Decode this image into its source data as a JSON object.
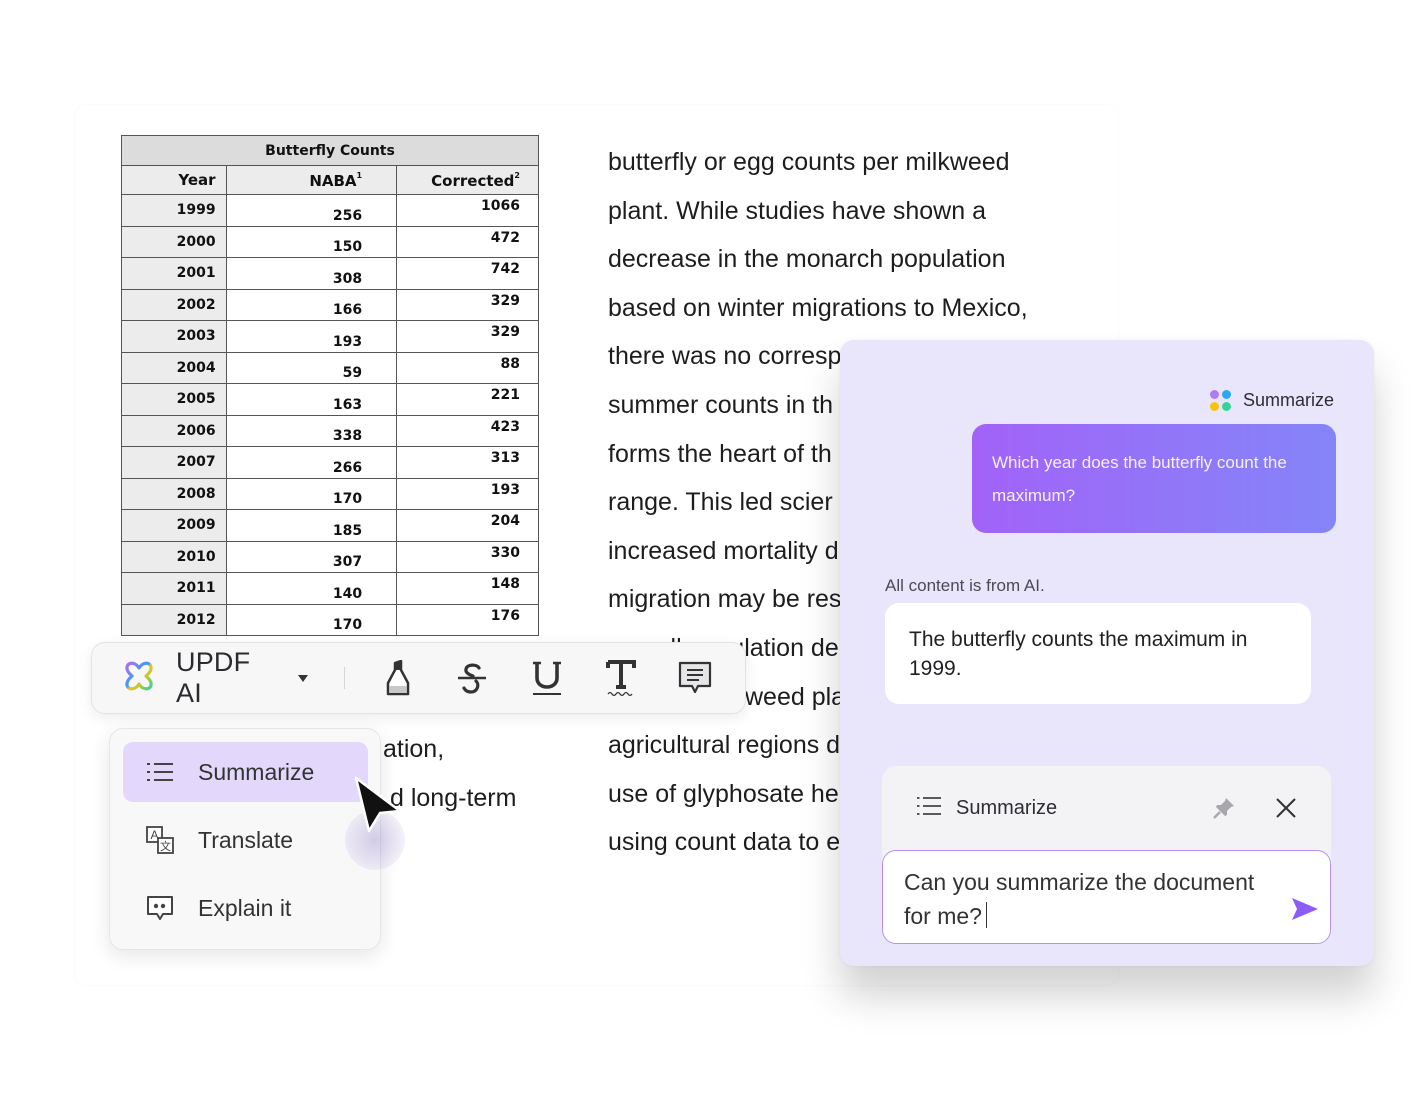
{
  "table": {
    "title": "Butterfly Counts",
    "columns": [
      {
        "label": "Year",
        "sup": ""
      },
      {
        "label": "NABA",
        "sup": "1"
      },
      {
        "label": "Corrected",
        "sup": "2"
      }
    ],
    "rows": [
      [
        "1999",
        "256",
        "1066"
      ],
      [
        "2000",
        "150",
        "472"
      ],
      [
        "2001",
        "308",
        "742"
      ],
      [
        "2002",
        "166",
        "329"
      ],
      [
        "2003",
        "193",
        "329"
      ],
      [
        "2004",
        "59",
        "88"
      ],
      [
        "2005",
        "163",
        "221"
      ],
      [
        "2006",
        "338",
        "423"
      ],
      [
        "2007",
        "266",
        "313"
      ],
      [
        "2008",
        "170",
        "193"
      ],
      [
        "2009",
        "185",
        "204"
      ],
      [
        "2010",
        "307",
        "330"
      ],
      [
        "2011",
        "140",
        "148"
      ],
      [
        "2012",
        "170",
        "176"
      ]
    ]
  },
  "document": {
    "lines": [
      "butterfly or egg counts per milkweed",
      "plant. While studies have shown a",
      "decrease in the monarch population",
      "based on winter migrations to Mexico,",
      "there was no corresp",
      "summer counts in th",
      "forms the heart of th",
      "range. This led scier",
      "increased mortality d",
      "migration may be res",
      "overall population de",
      "weed pla",
      "agricultural regions d",
      "use of glyphosate he",
      "using count data to e"
    ],
    "left_fragments": [
      "ation,",
      "d long-term"
    ]
  },
  "toolbar": {
    "ai_label": "UPDF AI",
    "tools": [
      {
        "name": "highlight-tool",
        "icon": "highlighter-icon"
      },
      {
        "name": "strikethrough-tool",
        "icon": "strikethrough-icon"
      },
      {
        "name": "underline-tool",
        "icon": "underline-icon"
      },
      {
        "name": "squiggly-text-tool",
        "icon": "text-squiggly-icon"
      },
      {
        "name": "comment-tool",
        "icon": "comment-icon"
      }
    ]
  },
  "menu": {
    "items": [
      {
        "label": "Summarize",
        "icon": "list-icon",
        "active": true
      },
      {
        "label": "Translate",
        "icon": "translate-icon",
        "active": false
      },
      {
        "label": "Explain it",
        "icon": "explain-icon",
        "active": false
      }
    ]
  },
  "ai_panel": {
    "mode_label": "Summarize",
    "user_message": "Which year does the butterfly count the maximum?",
    "disclaimer": "All content is from AI.",
    "ai_answer": "The butterfly counts the maximum in 1999.",
    "prompt_mode_label": "Summarize",
    "input_value": "Can you summarize the document for me?",
    "colors": {
      "bubble_start": "#a262f8",
      "bubble_end": "#8584f7",
      "panel_bg": "#e9e6fc",
      "send": "#8d5cf6",
      "dots": [
        "#b07cf5",
        "#2aa7f5",
        "#f9c20f",
        "#34d399"
      ]
    }
  }
}
